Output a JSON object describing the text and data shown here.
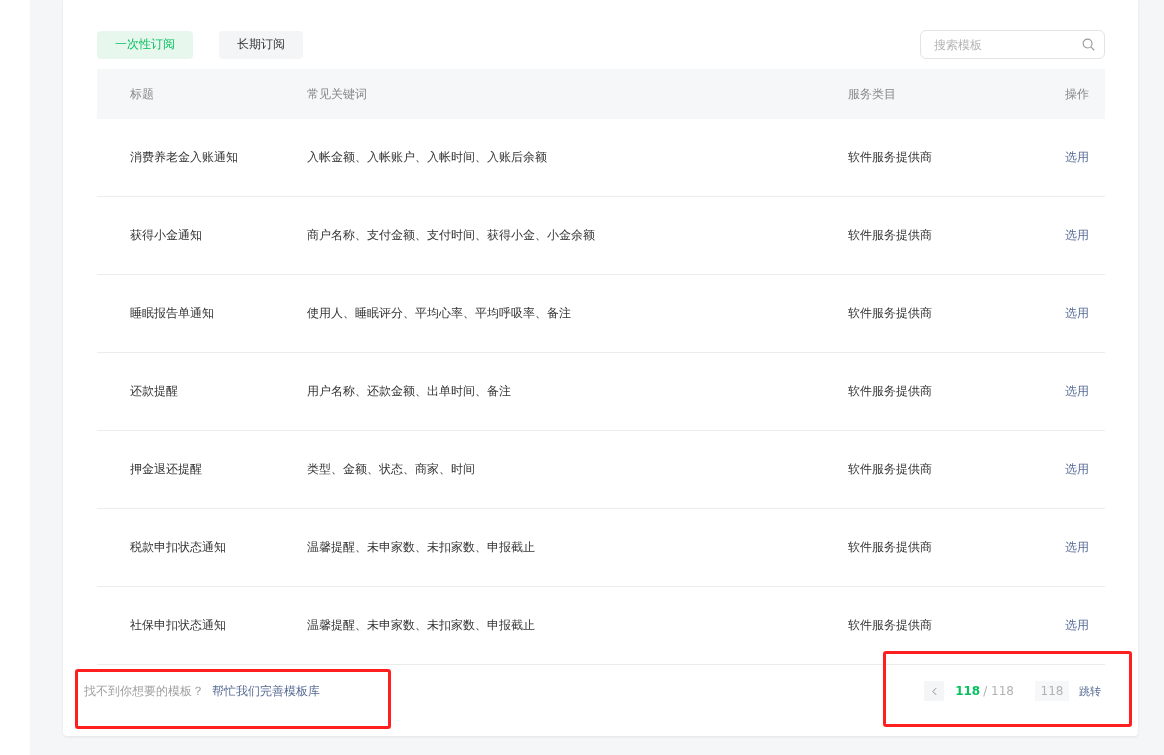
{
  "tabs": [
    {
      "label": "一次性订阅",
      "selected": true
    },
    {
      "label": "长期订阅",
      "selected": false
    }
  ],
  "search": {
    "placeholder": "搜索模板"
  },
  "table": {
    "columns": [
      "标题",
      "常见关键词",
      "服务类目",
      "操作"
    ],
    "rows": [
      {
        "title": "消费养老金入账通知",
        "keywords": "入帐金额、入帐账户、入帐时间、入账后余额",
        "category": "软件服务提供商",
        "action": "选用"
      },
      {
        "title": "获得小金通知",
        "keywords": "商户名称、支付金额、支付时间、获得小金、小金余额",
        "category": "软件服务提供商",
        "action": "选用"
      },
      {
        "title": "睡眠报告单通知",
        "keywords": "使用人、睡眠评分、平均心率、平均呼吸率、备注",
        "category": "软件服务提供商",
        "action": "选用"
      },
      {
        "title": "还款提醒",
        "keywords": "用户名称、还款金额、出单时间、备注",
        "category": "软件服务提供商",
        "action": "选用"
      },
      {
        "title": "押金退还提醒",
        "keywords": "类型、金额、状态、商家、时间",
        "category": "软件服务提供商",
        "action": "选用"
      },
      {
        "title": "税款申扣状态通知",
        "keywords": "温馨提醒、未申家数、未扣家数、申报截止",
        "category": "软件服务提供商",
        "action": "选用"
      },
      {
        "title": "社保申扣状态通知",
        "keywords": "温馨提醒、未申家数、未扣家数、申报截止",
        "category": "软件服务提供商",
        "action": "选用"
      }
    ]
  },
  "footer": {
    "note": "找不到你想要的模板？",
    "link": "帮忙我们完善模板库",
    "highlighted": true
  },
  "pagination": {
    "current": "118",
    "total": "/ 118",
    "jump_placeholder": "118",
    "jump_label": "跳转",
    "highlighted": true
  }
}
